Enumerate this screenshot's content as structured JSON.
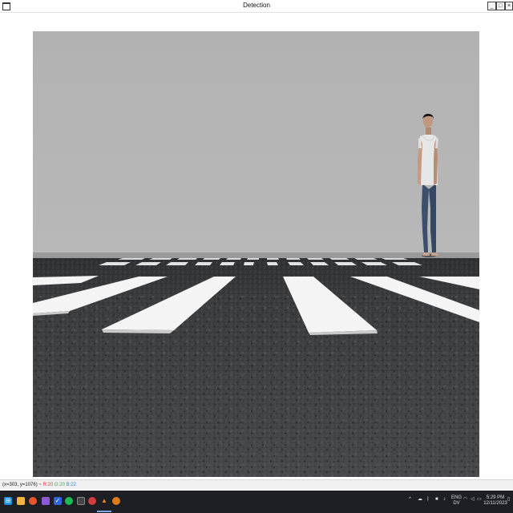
{
  "window": {
    "title": "Detection",
    "controls": [
      "minimize",
      "maximize",
      "close"
    ],
    "minimize_glyph": "_",
    "maximize_glyph": "□",
    "close_glyph": "×"
  },
  "scene": {
    "description_icon": "crosswalk-scene",
    "sky_color": "#b3b3b3",
    "road_color": "#3c3d3f",
    "stripe_color": "#f4f4f4"
  },
  "status": {
    "coords": "(x=303, y=1076) ~ ",
    "r": "R:20",
    "g": "G:20",
    "b": "B:22",
    "r_color": "#e53935",
    "g_color": "#43a047",
    "b_color": "#1e88e5"
  },
  "taskbar": {
    "icons": [
      "windows-start-icon",
      "file-explorer-icon",
      "firefox-icon",
      "app-purple-icon",
      "todo-check-icon",
      "spotify-icon",
      "terminal-icon",
      "clock-app-icon",
      "vlc-icon",
      "app-orange-icon"
    ],
    "tray": {
      "lang_top": "ENG",
      "lang_bottom": "DV",
      "time": "5:29 PM",
      "date": "12/11/2023"
    }
  }
}
